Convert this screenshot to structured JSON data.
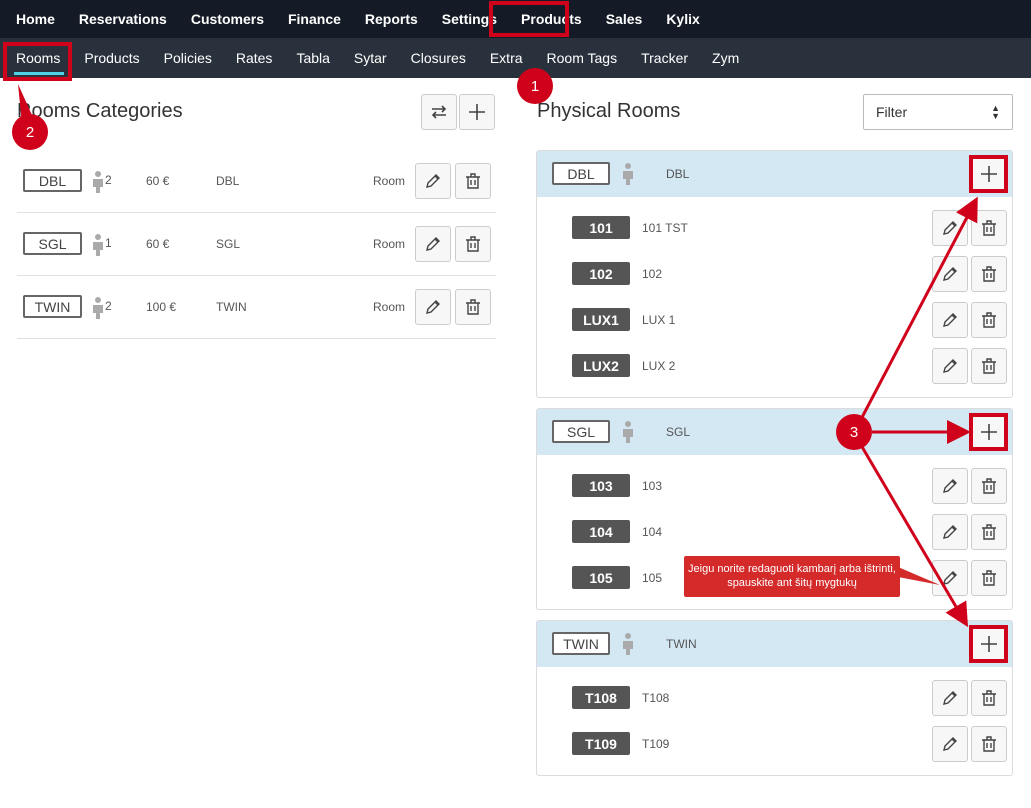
{
  "topnav": {
    "items": [
      "Home",
      "Reservations",
      "Customers",
      "Finance",
      "Reports",
      "Settings",
      "Products",
      "Sales",
      "Kylix"
    ]
  },
  "subnav": {
    "items": [
      "Rooms",
      "Products",
      "Policies",
      "Rates",
      "Tabla",
      "Sytar",
      "Closures",
      "Extra",
      "Room Tags",
      "Tracker",
      "Zym"
    ]
  },
  "left": {
    "title": "Rooms Categories",
    "categories": [
      {
        "code": "DBL",
        "persons": "2",
        "price": "60 €",
        "name": "DBL",
        "type": "Room"
      },
      {
        "code": "SGL",
        "persons": "1",
        "price": "60 €",
        "name": "SGL",
        "type": "Room"
      },
      {
        "code": "TWIN",
        "persons": "2",
        "price": "100 €",
        "name": "TWIN",
        "type": "Room"
      }
    ]
  },
  "right": {
    "title": "Physical Rooms",
    "filter_value": "Filter",
    "groups": [
      {
        "code": "DBL",
        "name": "DBL",
        "rooms": [
          {
            "tag": "101",
            "name": "101 TST"
          },
          {
            "tag": "102",
            "name": "102"
          },
          {
            "tag": "LUX1",
            "name": "LUX 1"
          },
          {
            "tag": "LUX2",
            "name": "LUX 2"
          }
        ]
      },
      {
        "code": "SGL",
        "name": "SGL",
        "rooms": [
          {
            "tag": "103",
            "name": "103"
          },
          {
            "tag": "104",
            "name": "104"
          },
          {
            "tag": "105",
            "name": "105"
          }
        ]
      },
      {
        "code": "TWIN",
        "name": "TWIN",
        "rooms": [
          {
            "tag": "T108",
            "name": "T108"
          },
          {
            "tag": "T109",
            "name": "T109"
          }
        ]
      }
    ]
  },
  "annotations": {
    "markers": [
      "1",
      "2",
      "3"
    ],
    "tooltip": "Jeigu norite redaguoti kambarį arba ištrinti, spauskite ant šitų mygtukų",
    "color": "#d0021b"
  },
  "icons": {
    "edit": "pencil-icon",
    "delete": "trash-icon",
    "add": "plus-icon",
    "swap": "swap-arrows-icon",
    "person": "person-icon"
  }
}
